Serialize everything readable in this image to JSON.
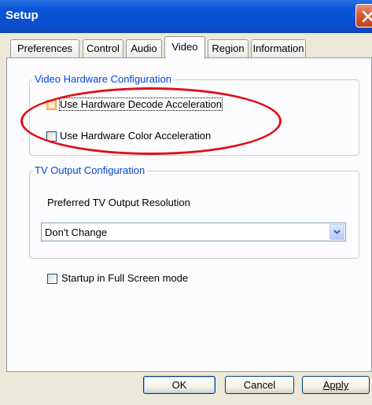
{
  "window": {
    "title": "Setup",
    "close_icon": "close-icon"
  },
  "tabs": [
    {
      "label": "Preferences",
      "active": false
    },
    {
      "label": "Control",
      "active": false
    },
    {
      "label": "Audio",
      "active": false
    },
    {
      "label": "Video",
      "active": true
    },
    {
      "label": "Region",
      "active": false
    },
    {
      "label": "Information",
      "active": false
    }
  ],
  "video_hw": {
    "legend": "Video Hardware Configuration",
    "decode": {
      "label": "Use Hardware Decode Acceleration",
      "checked": false
    },
    "color": {
      "label": "Use Hardware Color Acceleration",
      "checked": false
    }
  },
  "tv_output": {
    "legend": "TV Output Configuration",
    "resolution_label": "Preferred TV Output Resolution",
    "resolution_value": "Don't Change"
  },
  "fullscreen": {
    "label": "Startup in Full Screen mode",
    "checked": false
  },
  "buttons": {
    "ok": "OK",
    "cancel": "Cancel",
    "apply": "Apply"
  },
  "colors": {
    "titlebar": "#0a4fcf",
    "annotation": "#e0101a",
    "group_legend": "#0046d5",
    "dialog_bg": "#ece9d8"
  }
}
